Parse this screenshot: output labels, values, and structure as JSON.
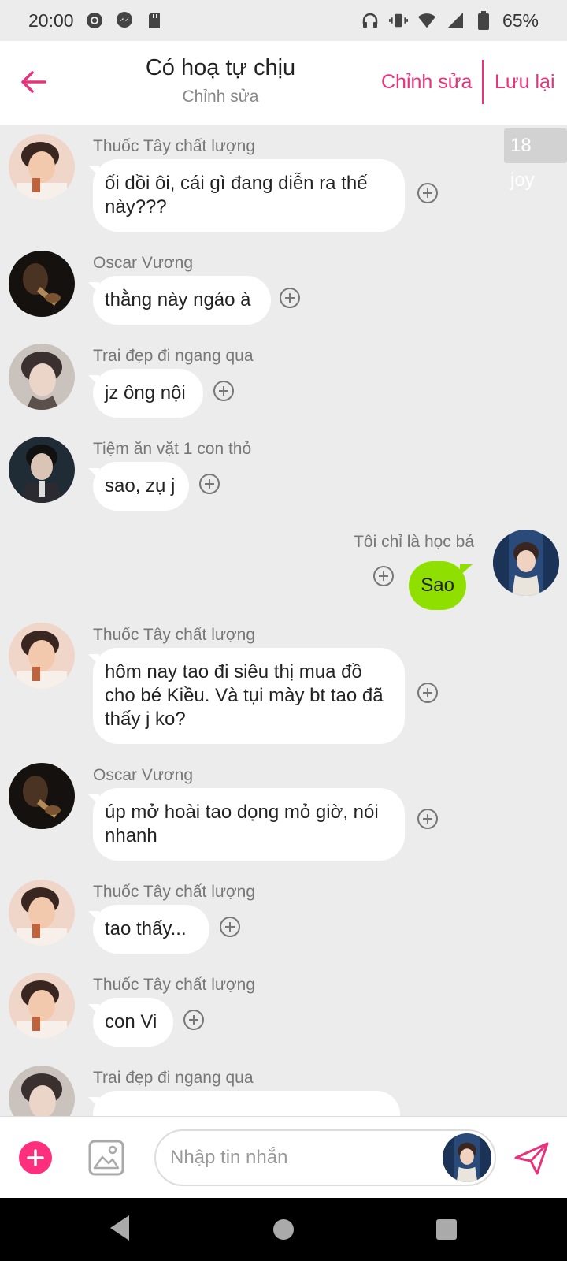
{
  "status_bar": {
    "time": "20:00",
    "battery": "65%"
  },
  "header": {
    "title": "Có hoạ tự chịu",
    "subtitle": "Chỉnh sửa",
    "edit_label": "Chỉnh sửa",
    "save_label": "Lưu lại"
  },
  "badge": "18 joy",
  "messages": [
    {
      "sender": "Thuốc Tây chất lượng",
      "text": "ối dồi ôi, cái gì đang diễn ra thế này???",
      "mine": false
    },
    {
      "sender": "Oscar Vương",
      "text": "thằng này ngáo à",
      "mine": false
    },
    {
      "sender": "Trai đẹp đi ngang qua",
      "text": "jz ông nội",
      "mine": false
    },
    {
      "sender": "Tiệm ăn vặt 1 con thỏ",
      "text": "sao, zụ j",
      "mine": false
    },
    {
      "sender": "Tôi chỉ là học bá",
      "text": "Sao",
      "mine": true
    },
    {
      "sender": "Thuốc Tây chất lượng",
      "text": "hôm nay tao đi siêu thị mua đồ cho bé Kiều. Và tụi mày bt tao đã thấy j ko?",
      "mine": false
    },
    {
      "sender": "Oscar Vương",
      "text": "úp mở hoài tao dọng mỏ giờ, nói nhanh",
      "mine": false
    },
    {
      "sender": "Thuốc Tây chất lượng",
      "text": "tao thấy...",
      "mine": false
    },
    {
      "sender": "Thuốc Tây chất lượng",
      "text": "con Vi",
      "mine": false
    },
    {
      "sender": "Trai đẹp đi ngang qua",
      "text": "",
      "mine": false
    }
  ],
  "input": {
    "placeholder": "Nhập tin nhắn"
  },
  "colors": {
    "accent": "#e8327c",
    "my_bubble": "#8fe000",
    "background": "#ececec"
  }
}
